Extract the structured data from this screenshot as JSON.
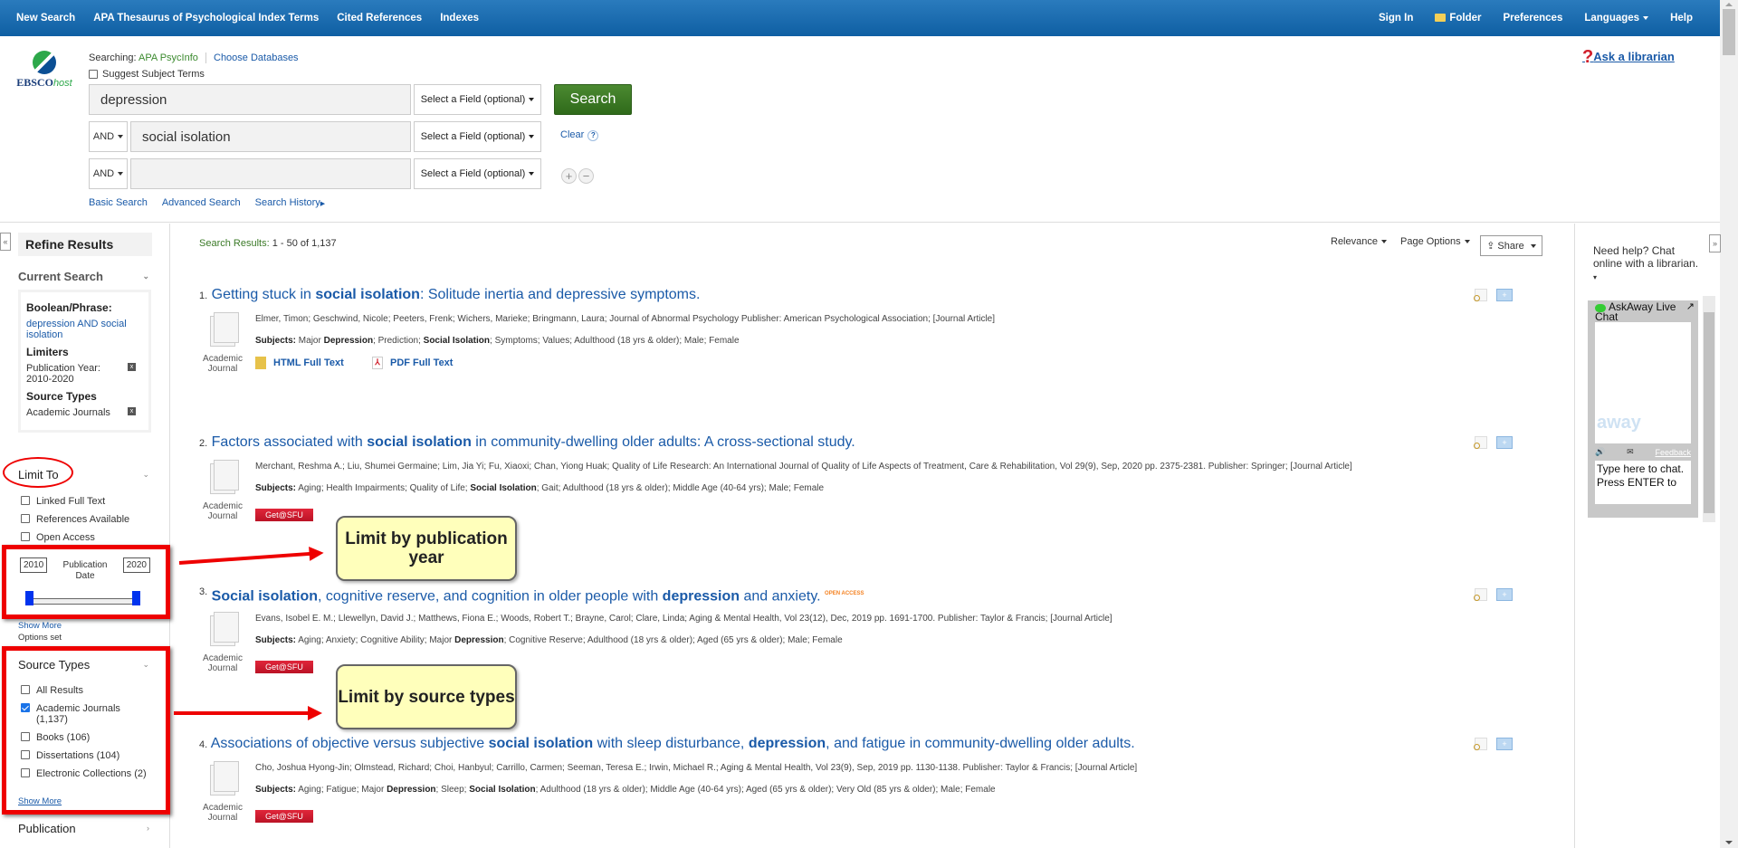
{
  "topnav": {
    "left": [
      "New Search",
      "APA Thesaurus of Psychological Index Terms",
      "Cited References",
      "Indexes"
    ],
    "sign_in": "Sign In",
    "folder": "Folder",
    "preferences": "Preferences",
    "languages": "Languages",
    "help": "Help"
  },
  "header": {
    "logo_text": "EBSCO",
    "logo_suffix": "host",
    "searching_label": "Searching:",
    "database": "APA PsycInfo",
    "choose_databases": "Choose Databases",
    "suggest_terms": "Suggest Subject Terms",
    "rows": [
      {
        "operator": "",
        "value": "depression",
        "field": "Select a Field (optional)"
      },
      {
        "operator": "AND",
        "value": "social isolation",
        "field": "Select a Field (optional)"
      },
      {
        "operator": "AND",
        "value": "",
        "field": "Select a Field (optional)"
      }
    ],
    "search_button": "Search",
    "clear": "Clear",
    "help_q": "?",
    "plus": "+",
    "minus": "−",
    "links": [
      "Basic Search",
      "Advanced Search",
      "Search History"
    ],
    "ask_librarian": "Ask a librarian"
  },
  "sidebar": {
    "collapse": "«",
    "refine": "Refine Results",
    "current_search": "Current Search",
    "boolean_label": "Boolean/Phrase:",
    "boolean_value": "depression AND social isolation",
    "limiters_label": "Limiters",
    "limiter_value": "Publication Year: 2010-2020",
    "source_types_label": "Source Types",
    "source_type_value": "Academic Journals",
    "remove": "x",
    "limit_to": "Limit To",
    "limit_options": [
      {
        "label": "Linked Full Text",
        "checked": false
      },
      {
        "label": "References Available",
        "checked": false
      },
      {
        "label": "Open Access",
        "checked": false
      }
    ],
    "pub_date": {
      "from": "2010",
      "to": "2020",
      "label": "Publication Date",
      "range_fraction": [
        0.0,
        1.0
      ]
    },
    "show_more": "Show More",
    "options_set": "Options set",
    "source_types": {
      "title": "Source Types",
      "items": [
        {
          "label": "All Results",
          "checked": false
        },
        {
          "label": "Academic Journals (1,137)",
          "checked": true
        },
        {
          "label": "Books (106)",
          "checked": false
        },
        {
          "label": "Dissertations (104)",
          "checked": false
        },
        {
          "label": "Electronic Collections (2)",
          "checked": false
        }
      ],
      "show_more": "Show More"
    },
    "publication": "Publication"
  },
  "results": {
    "count_label": "Search Results:",
    "count_value": "1 - 50 of 1,137",
    "sort": "Relevance",
    "page_options": "Page Options",
    "share": "Share",
    "type_label": "Academic Journal",
    "get_sfu": "Get@SFU",
    "subjects_label": "Subjects:",
    "items": [
      {
        "num": "1.",
        "title_parts": [
          [
            "Getting stuck in ",
            false
          ],
          [
            "social isolation",
            true
          ],
          [
            ": Solitude inertia and depressive symptoms.",
            false
          ]
        ],
        "citation": "Elmer, Timon; Geschwind, Nicole; Peeters, Frenk; Wichers, Marieke; Bringmann, Laura; Journal of Abnormal Psychology Publisher: American Psychological Association; [Journal Article]",
        "subject_parts": [
          [
            "Major ",
            false
          ],
          [
            "Depression",
            true
          ],
          [
            "; Prediction; ",
            false
          ],
          [
            "Social Isolation",
            true
          ],
          [
            "; Symptoms; Values; Adulthood (18 yrs & older); Male; Female",
            false
          ]
        ],
        "html_full_text": "HTML Full Text",
        "pdf_full_text": "PDF Full Text"
      },
      {
        "num": "2.",
        "title_parts": [
          [
            "Factors associated with ",
            false
          ],
          [
            "social isolation",
            true
          ],
          [
            " in community-dwelling older adults: A cross-sectional study.",
            false
          ]
        ],
        "citation": "Merchant, Reshma A.; Liu, Shumei Germaine; Lim, Jia Yi; Fu, Xiaoxi; Chan, Yiong Huak; Quality of Life Research: An International Journal of Quality of Life Aspects of Treatment, Care & Rehabilitation, Vol 29(9), Sep, 2020 pp. 2375-2381. Publisher: Springer; [Journal Article]",
        "subject_parts": [
          [
            "Aging; Health Impairments; Quality of Life; ",
            false
          ],
          [
            "Social Isolation",
            true
          ],
          [
            "; Gait; Adulthood (18 yrs & older); Middle Age (40-64 yrs); Male; Female",
            false
          ]
        ]
      },
      {
        "num": "3.",
        "title_parts": [
          [
            "Social isolation",
            true
          ],
          [
            ", cognitive reserve, and cognition in older people with ",
            false
          ],
          [
            "depression",
            true
          ],
          [
            " and anxiety.",
            false
          ]
        ],
        "open_access": "OPEN ACCESS",
        "citation": "Evans, Isobel E. M.; Llewellyn, David J.; Matthews, Fiona E.; Woods, Robert T.; Brayne, Carol; Clare, Linda; Aging & Mental Health, Vol 23(12), Dec, 2019 pp. 1691-1700. Publisher: Taylor & Francis; [Journal Article]",
        "subject_parts": [
          [
            "Aging; Anxiety; Cognitive Ability; Major ",
            false
          ],
          [
            "Depression",
            true
          ],
          [
            "; Cognitive Reserve; Adulthood (18 yrs & older); Aged (65 yrs & older); Male; Female",
            false
          ]
        ]
      },
      {
        "num": "4.",
        "title_parts": [
          [
            "Associations of objective versus subjective ",
            false
          ],
          [
            "social isolation",
            true
          ],
          [
            " with sleep disturbance, ",
            false
          ],
          [
            "depression",
            true
          ],
          [
            ", and fatigue in community-dwelling older adults.",
            false
          ]
        ],
        "citation": "Cho, Joshua Hyong-Jin; Olmstead, Richard; Choi, Hanbyul; Carrillo, Carmen; Seeman, Teresa E.; Irwin, Michael R.; Aging & Mental Health, Vol 23(9), Sep, 2019 pp. 1130-1138. Publisher: Taylor & Francis; [Journal Article]",
        "subject_parts": [
          [
            "Aging; Fatigue; Major ",
            false
          ],
          [
            "Depression",
            true
          ],
          [
            "; Sleep; ",
            false
          ],
          [
            "Social Isolation",
            true
          ],
          [
            "; Adulthood (18 yrs & older); Middle Age (40-64 yrs); Aged (65 yrs & older); Very Old (85 yrs & older); Male; Female",
            false
          ]
        ]
      }
    ]
  },
  "annotations": {
    "callout_year": "Limit by publication year",
    "callout_source": "Limit by source types"
  },
  "chat": {
    "expand": "»",
    "need_help": "Need help? Chat online with a librarian.",
    "title": "AskAway Live Chat",
    "watermark": "away",
    "feedback": "Feedback",
    "input_placeholder": "Type here to chat. Press ENTER to"
  },
  "colors": {
    "nav_top": "#2a7bbd",
    "search_green": "#3b7a24",
    "link_blue": "#1a5aa8",
    "getsfu_red": "#d01e2a",
    "callout_yellow": "#ffffbb",
    "annotation_red": "#ee0000"
  }
}
